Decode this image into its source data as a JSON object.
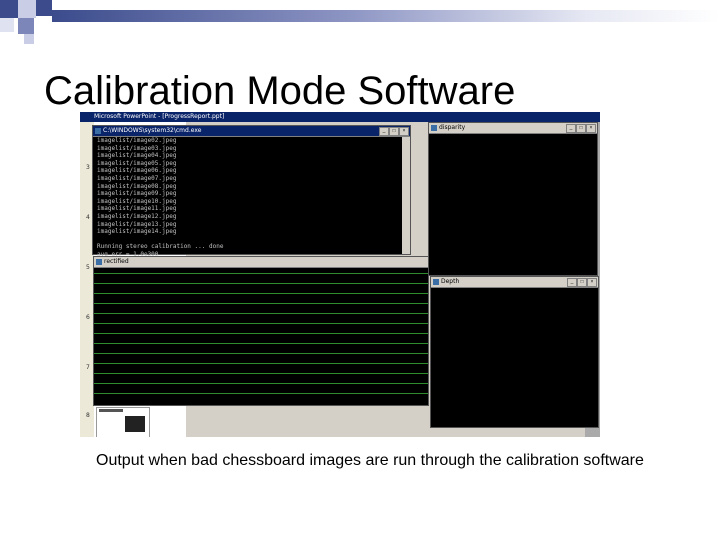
{
  "slide": {
    "title": "Calibration Mode Software",
    "caption": "Output when bad chessboard images are run through the calibration software"
  },
  "screenshot": {
    "powerpoint_title": "Microsoft PowerPoint - [ProgressReport.ppt]",
    "slide_numbers": [
      "3",
      "4",
      "5",
      "6",
      "7",
      "8"
    ],
    "console": {
      "title": "C:\\WINDOWS\\system32\\cmd.exe",
      "lines": [
        "imagelist/image02.jpeg",
        "imagelist/image03.jpeg",
        "imagelist/image04.jpeg",
        "imagelist/image05.jpeg",
        "imagelist/image06.jpeg",
        "imagelist/image07.jpeg",
        "imagelist/image08.jpeg",
        "imagelist/image09.jpeg",
        "imagelist/image10.jpeg",
        "imagelist/image11.jpeg",
        "imagelist/image12.jpeg",
        "imagelist/image13.jpeg",
        "imagelist/image14.jpeg",
        "",
        "Running stereo calibration ... done",
        "avg err = 1.0e300"
      ]
    },
    "disparity_title": "disparity",
    "rectified_title": "rectified",
    "depth_title": "Depth",
    "window_buttons": [
      "_",
      "□",
      "×"
    ]
  }
}
